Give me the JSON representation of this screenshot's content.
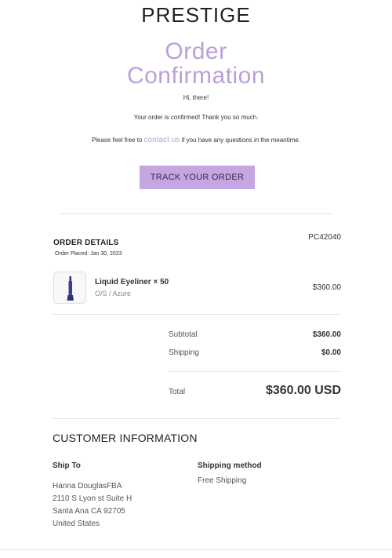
{
  "header": {
    "brand": "PRESTIGE",
    "title_line1": "Order",
    "title_line2": "Confirmation",
    "greeting": "Hi, there!",
    "confirmed": "Your order is confirmed! Thank you so much.",
    "contact_prefix": "Please feel free to ",
    "contact_link": "contact us",
    "contact_suffix": " if you have any questions in the meantime.",
    "track_button": "TRACK YOUR ORDER"
  },
  "order": {
    "heading": "ORDER DETAILS",
    "placed": "Order Placed: Jan 30, 2023",
    "number": "PC42040",
    "items": [
      {
        "name": "Liquid Eyeliner × 50",
        "variant": "O/S / Azure",
        "price": "$360.00",
        "icon": "eyeliner-icon"
      }
    ],
    "subtotal_label": "Subtotal",
    "subtotal": "$360.00",
    "shipping_label": "Shipping",
    "shipping": "$0.00",
    "total_label": "Total",
    "total": "$360.00 USD"
  },
  "customer": {
    "heading": "CUSTOMER INFORMATION",
    "ship_to_label": "Ship To",
    "address": [
      "Hanna DouglasFBA",
      "2110 S Lyon st Suite H",
      "Santa Ana CA 92705",
      "United States"
    ],
    "shipping_method_label": "Shipping method",
    "shipping_method": "Free Shipping"
  },
  "colors": {
    "accent": "#b9a0dd",
    "button": "#c4a6e3",
    "product": "#3b3f8f"
  }
}
